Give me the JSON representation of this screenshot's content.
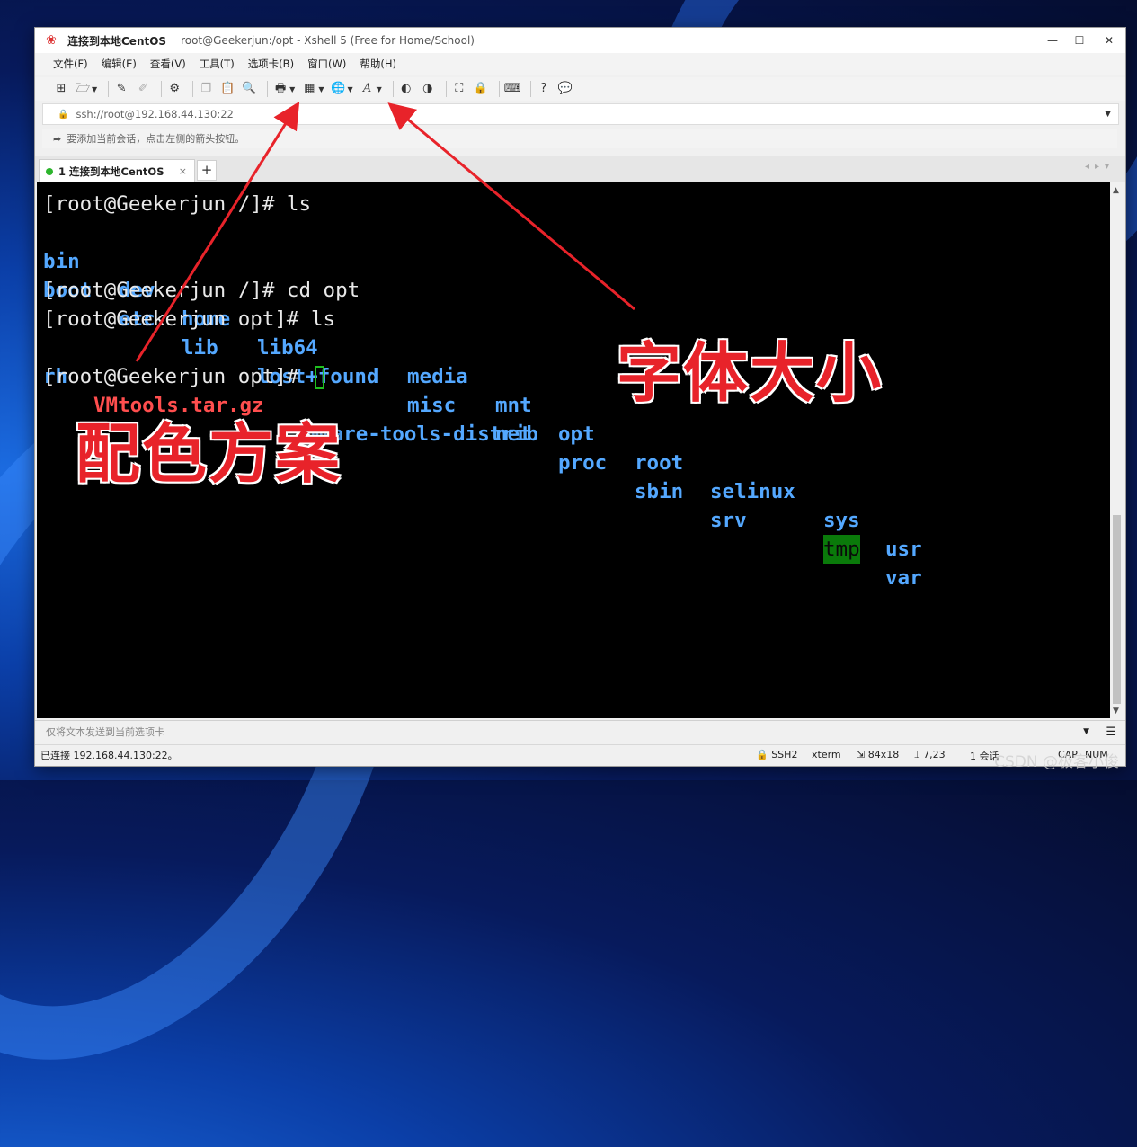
{
  "window": {
    "title": "连接到本地CentOS",
    "subtitle": "root@Geekerjun:/opt - Xshell 5 (Free for Home/School)",
    "controls": [
      "—",
      "☐",
      "✕"
    ]
  },
  "menu": [
    "文件(F)",
    "编辑(E)",
    "查看(V)",
    "工具(T)",
    "选项卡(B)",
    "窗口(W)",
    "帮助(H)"
  ],
  "address": {
    "value": "ssh://root@192.168.44.130:22"
  },
  "hint": "要添加当前会话，点击左侧的箭头按钮。",
  "tab": {
    "label": "1 连接到本地CentOS",
    "close": "×",
    "add": "+"
  },
  "terminal": {
    "line1": "[root@Geekerjun /]# ls",
    "dirs_row1": [
      "bin",
      "dev",
      "home",
      "lib64",
      "media",
      "mnt",
      "opt",
      "root",
      "selinux",
      "sys",
      "usr"
    ],
    "dirs_row2": [
      "boot",
      "etc",
      "lib",
      "lost+found",
      "misc",
      "net",
      "proc",
      "sbin",
      "srv",
      "tmp",
      "var"
    ],
    "line4": "[root@Geekerjun /]# cd opt",
    "line5": "[root@Geekerjun opt]# ls",
    "ls_opt": {
      "dir1": "rh",
      "archive": "VMtools.tar.gz",
      "dir2": "vmware-tools-distrib"
    },
    "line7": "[root@Geekerjun opt]# "
  },
  "sendbar": {
    "placeholder": "仅将文本发送到当前选项卡"
  },
  "status": {
    "connection": "已连接 192.168.44.130:22。",
    "protocol": "SSH2",
    "term": "xterm",
    "size": "84x18",
    "cursor": "7,23",
    "sessions": "1 会话",
    "caps": "CAP",
    "num": "NUM"
  },
  "annotations": {
    "color_scheme": "配色方案",
    "font_size": "字体大小"
  },
  "watermark": "CSDN @极客小俊",
  "colors": {
    "annotation_red": "#e8232a",
    "dir_blue": "#54a8ff",
    "archive_red": "#ff4e4e",
    "cursor_green": "#1fbf1f"
  }
}
